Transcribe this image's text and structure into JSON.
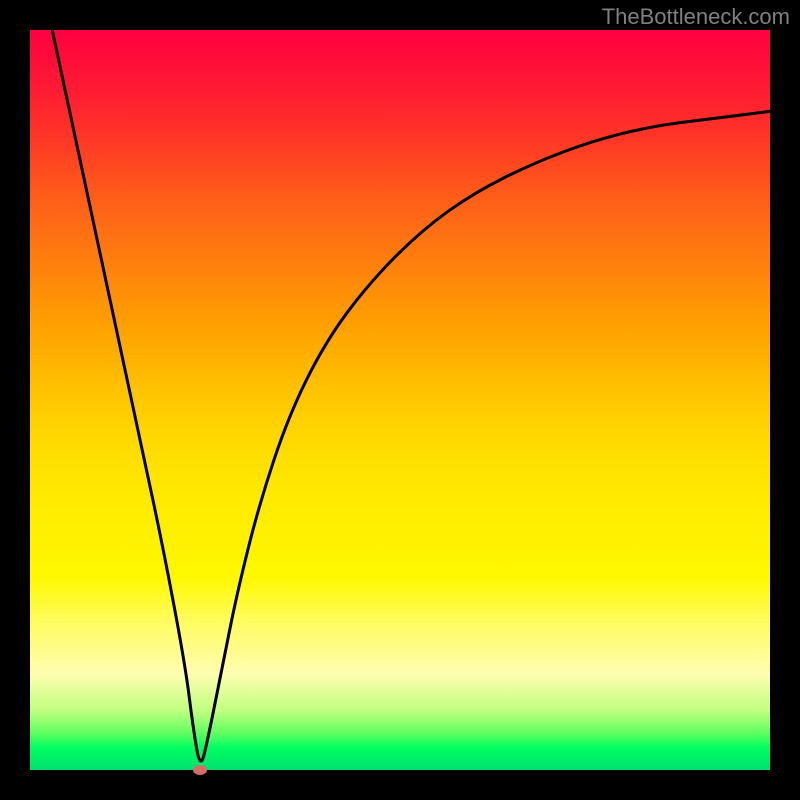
{
  "watermark": "TheBottleneck.com",
  "chart_data": {
    "type": "line",
    "title": "",
    "xlabel": "",
    "ylabel": "",
    "xlim": [
      0,
      100
    ],
    "ylim": [
      0,
      100
    ],
    "grid": false,
    "series": [
      {
        "name": "bottleneck-curve",
        "x": [
          3,
          6,
          9,
          12,
          15,
          18,
          21,
          22,
          23,
          24,
          26,
          28,
          31,
          35,
          40,
          46,
          53,
          60,
          68,
          76,
          84,
          92,
          100
        ],
        "values": [
          100,
          86,
          72,
          58,
          44,
          30,
          14,
          6,
          0,
          4,
          14,
          24,
          36,
          48,
          58,
          66,
          73,
          78,
          82,
          85,
          87,
          88,
          89
        ]
      }
    ],
    "marker": {
      "x": 23,
      "y": 0,
      "color": "#d86a6a"
    },
    "gradient_stops": [
      {
        "pct": 0,
        "color": "#ff0040"
      },
      {
        "pct": 40,
        "color": "#ffa000"
      },
      {
        "pct": 68,
        "color": "#fff000"
      },
      {
        "pct": 95,
        "color": "#60ff60"
      },
      {
        "pct": 100,
        "color": "#00e070"
      }
    ]
  }
}
